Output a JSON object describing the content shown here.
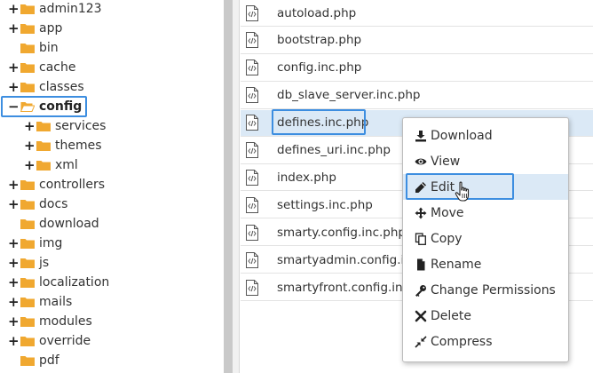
{
  "tree": {
    "items": [
      {
        "label": "admin123",
        "toggle": "+",
        "indent": 0
      },
      {
        "label": "app",
        "toggle": "+",
        "indent": 0
      },
      {
        "label": "bin",
        "toggle": "",
        "indent": 0
      },
      {
        "label": "cache",
        "toggle": "+",
        "indent": 0
      },
      {
        "label": "classes",
        "toggle": "+",
        "indent": 0
      },
      {
        "label": "config",
        "toggle": "−",
        "indent": 0,
        "selected": true,
        "open": true
      },
      {
        "label": "services",
        "toggle": "+",
        "indent": 1
      },
      {
        "label": "themes",
        "toggle": "+",
        "indent": 1
      },
      {
        "label": "xml",
        "toggle": "+",
        "indent": 1
      },
      {
        "label": "controllers",
        "toggle": "+",
        "indent": 0
      },
      {
        "label": "docs",
        "toggle": "+",
        "indent": 0
      },
      {
        "label": "download",
        "toggle": "",
        "indent": 0
      },
      {
        "label": "img",
        "toggle": "+",
        "indent": 0
      },
      {
        "label": "js",
        "toggle": "+",
        "indent": 0
      },
      {
        "label": "localization",
        "toggle": "+",
        "indent": 0
      },
      {
        "label": "mails",
        "toggle": "+",
        "indent": 0
      },
      {
        "label": "modules",
        "toggle": "+",
        "indent": 0
      },
      {
        "label": "override",
        "toggle": "+",
        "indent": 0
      },
      {
        "label": "pdf",
        "toggle": "",
        "indent": 0
      }
    ]
  },
  "files": [
    {
      "name": "autoload.php"
    },
    {
      "name": "bootstrap.php"
    },
    {
      "name": "config.inc.php"
    },
    {
      "name": "db_slave_server.inc.php"
    },
    {
      "name": "defines.inc.php",
      "selected": true
    },
    {
      "name": "defines_uri.inc.php"
    },
    {
      "name": "index.php"
    },
    {
      "name": "settings.inc.php"
    },
    {
      "name": "smarty.config.inc.php"
    },
    {
      "name": "smartyadmin.config.inc"
    },
    {
      "name": "smartyfront.config.inc.p"
    }
  ],
  "context_menu": {
    "items": [
      {
        "label": "Download",
        "icon": "download-icon"
      },
      {
        "label": "View",
        "icon": "eye-icon"
      },
      {
        "label": "Edit",
        "icon": "pencil-icon",
        "active": true
      },
      {
        "label": "Move",
        "icon": "move-arrows-icon"
      },
      {
        "label": "Copy",
        "icon": "copy-icon"
      },
      {
        "label": "Rename",
        "icon": "file-icon"
      },
      {
        "label": "Change Permissions",
        "icon": "key-icon"
      },
      {
        "label": "Delete",
        "icon": "x-icon"
      },
      {
        "label": "Compress",
        "icon": "compress-icon"
      }
    ]
  },
  "colors": {
    "folder": "#f0a830",
    "highlight": "#dbe9f6",
    "selection_border": "#3d8ee0"
  }
}
